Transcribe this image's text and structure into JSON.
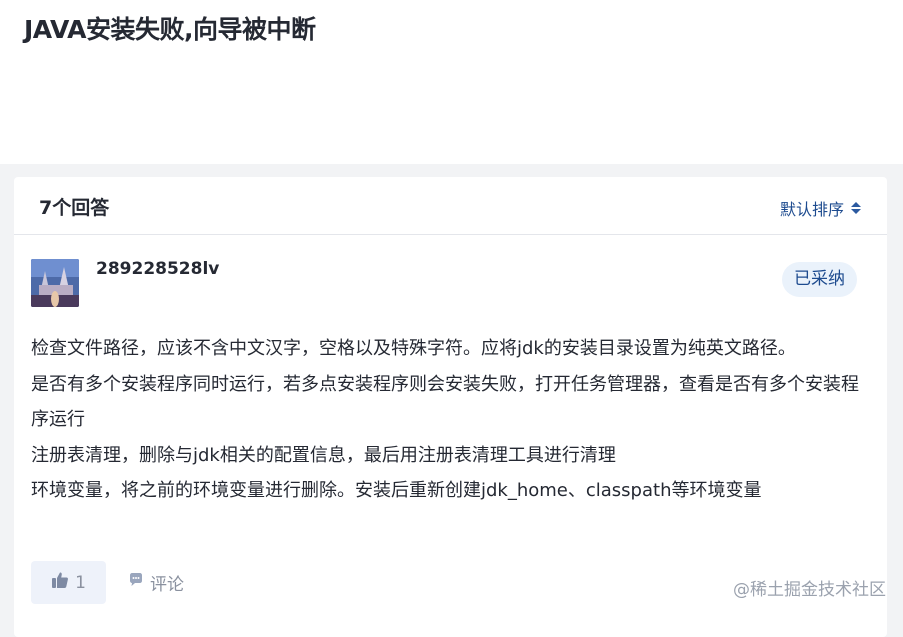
{
  "question": {
    "title": "JAVA安装失败,向导被中断"
  },
  "answers_header": {
    "count_label": "7个回答",
    "sort_label": "默认排序"
  },
  "answer": {
    "username": "289228528lv",
    "accepted_badge": "已采纳",
    "paragraphs": [
      "检查文件路径，应该不含中文汉字，空格以及特殊字符。应将jdk的安装目录设置为纯英文路径。",
      "是否有多个安装程序同时运行，若多点安装程序则会安装失败，打开任务管理器，查看是否有多个安装程序运行",
      "注册表清理，删除与jdk相关的配置信息，最后用注册表清理工具进行清理",
      "环境变量，将之前的环境变量进行删除。安装后重新创建jdk_home、classpath等环境变量"
    ],
    "like_count": "1",
    "comment_label": "评论"
  },
  "watermark": "@稀土掘金技术社区",
  "colors": {
    "accent": "#1d4b8f",
    "badge_bg": "#eaf2fb",
    "muted": "#8a919f"
  },
  "icons": {
    "sort": "sort-updown-icon",
    "like": "thumbs-up-icon",
    "comment": "comment-bubble-icon"
  }
}
